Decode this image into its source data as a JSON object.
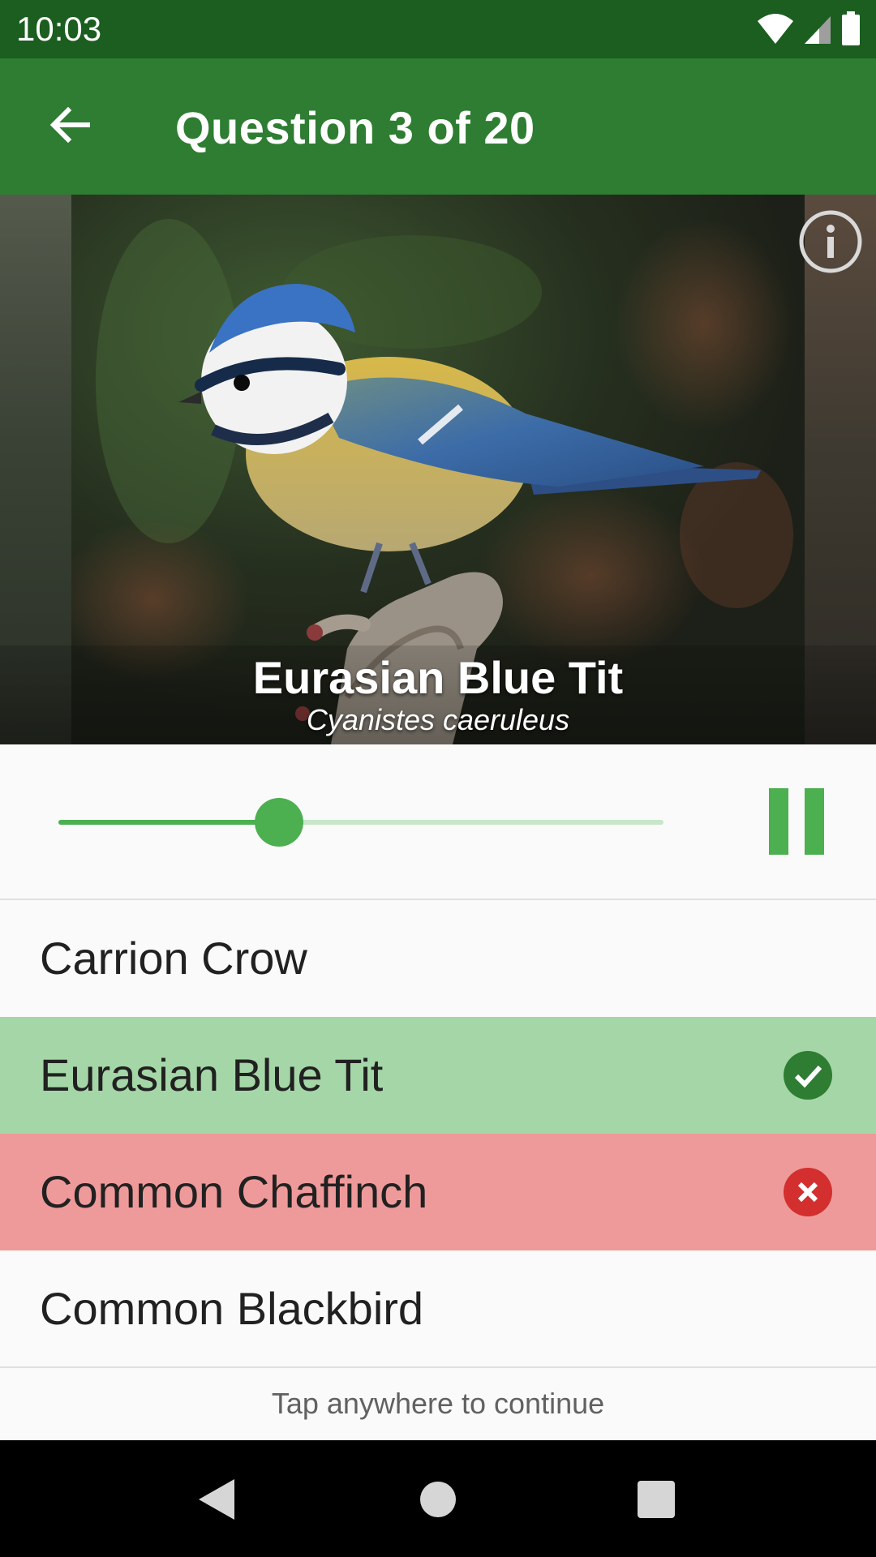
{
  "status_bar": {
    "time": "10:03",
    "icons": [
      "wifi-icon",
      "cell-signal-icon",
      "battery-icon"
    ]
  },
  "app_bar": {
    "title": "Question 3 of 20",
    "back_icon": "arrow-left-icon"
  },
  "photo": {
    "subject": "bird",
    "caption_name": "Eurasian Blue Tit",
    "caption_latin": "Cyanistes caeruleus",
    "info_icon": "info-icon"
  },
  "player": {
    "progress": 0.365,
    "state_icon": "pause-icon"
  },
  "answers": [
    {
      "label": "Carrion Crow",
      "state": "neutral",
      "icon": ""
    },
    {
      "label": "Eurasian Blue Tit",
      "state": "correct",
      "icon": "check-circle-icon"
    },
    {
      "label": "Common Chaffinch",
      "state": "wrong",
      "icon": "close-circle-icon"
    },
    {
      "label": "Common Blackbird",
      "state": "neutral",
      "icon": ""
    }
  ],
  "hint": "Tap anywhere to continue",
  "colors": {
    "status_bar": "#1b5e20",
    "app_bar": "#2e7d32",
    "accent": "#4caf50",
    "correct_bg": "#a5d6a7",
    "wrong_bg": "#ef9a9a",
    "correct_icon": "#2e7d32",
    "wrong_icon": "#d32f2f"
  },
  "nav_bar": {
    "icons": [
      "back-triangle-icon",
      "home-circle-icon",
      "recents-square-icon"
    ]
  }
}
